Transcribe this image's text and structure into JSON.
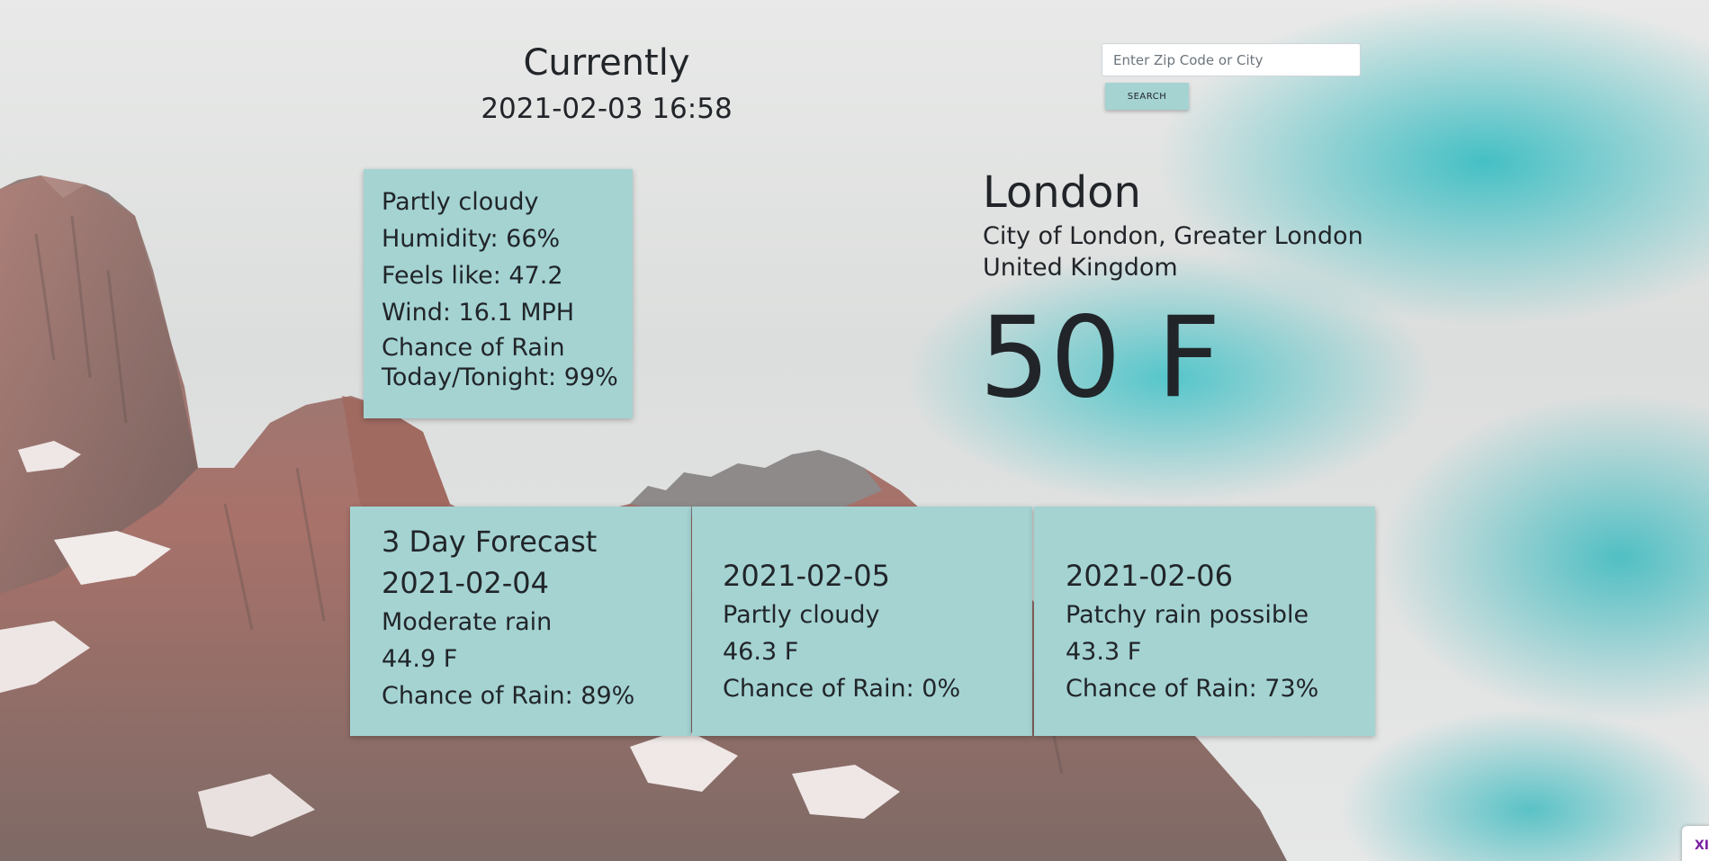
{
  "current": {
    "heading": "Currently",
    "datetime": "2021-02-03 16:58"
  },
  "search": {
    "placeholder": "Enter Zip Code or City",
    "value": "",
    "button_label": "SEARCH"
  },
  "details": {
    "condition": "Partly cloudy",
    "humidity": "Humidity: 66%",
    "feels_like": "Feels like: 47.2",
    "wind": "Wind: 16.1 MPH",
    "rain_line1": "Chance of Rain",
    "rain_line2": "Today/Tonight: 99%"
  },
  "location": {
    "city": "London",
    "region": "City of London, Greater London",
    "country": "United Kingdom",
    "temperature": "50 F"
  },
  "forecast": {
    "title": "3 Day Forecast",
    "days": [
      {
        "date": "2021-02-04",
        "condition": "Moderate rain",
        "temp": "44.9 F",
        "rain": "Chance of Rain: 89%"
      },
      {
        "date": "2021-02-05",
        "condition": "Partly cloudy",
        "temp": "46.3 F",
        "rain": "Chance of Rain: 0%"
      },
      {
        "date": "2021-02-06",
        "condition": "Patchy rain possible",
        "temp": "43.3 F",
        "rain": "Chance of Rain: 73%"
      }
    ]
  },
  "corner_badge": "XI",
  "colors": {
    "card": "#a4d3d2",
    "text": "#212529",
    "sky": "#3cbec3",
    "rock": "#9a6e62"
  }
}
